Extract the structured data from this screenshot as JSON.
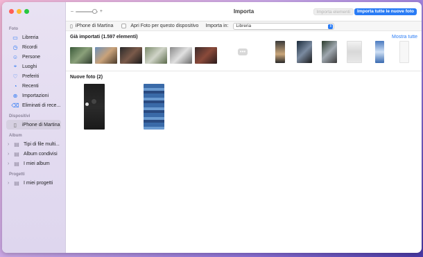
{
  "window": {
    "title": "Importa"
  },
  "sidebar": {
    "sections": [
      {
        "title": "Foto",
        "items": [
          {
            "label": "Libreria",
            "icon": "library-icon"
          },
          {
            "label": "Ricordi",
            "icon": "memories-icon"
          },
          {
            "label": "Persone",
            "icon": "people-icon"
          },
          {
            "label": "Luoghi",
            "icon": "places-icon"
          },
          {
            "label": "Preferiti",
            "icon": "heart-icon"
          },
          {
            "label": "Recenti",
            "icon": "clock-icon"
          },
          {
            "label": "Importazioni",
            "icon": "import-icon"
          },
          {
            "label": "Eliminati di rece...",
            "icon": "trash-icon"
          }
        ]
      },
      {
        "title": "Dispositivi",
        "items": [
          {
            "label": "iPhone di Martina",
            "icon": "iphone-icon"
          }
        ]
      },
      {
        "title": "Album",
        "items": [
          {
            "label": "Tipi di file multi...",
            "icon": "folder-icon"
          },
          {
            "label": "Album condivisi",
            "icon": "folder-icon"
          },
          {
            "label": "I miei album",
            "icon": "folder-icon"
          }
        ]
      },
      {
        "title": "Progetti",
        "items": [
          {
            "label": "I miei progetti",
            "icon": "folder-icon"
          }
        ]
      }
    ]
  },
  "titlebar": {
    "import_selected": "Importa elementi",
    "import_all": "Importa tutte le nuove foto"
  },
  "toolbar": {
    "device": "iPhone di Martina",
    "open_photos": "Apri Foto per questo dispositivo",
    "import_in_label": "Importa in:",
    "import_in_value": "Libreria"
  },
  "already_imported": {
    "title": "Già importati (1.597 elementi)",
    "show_all": "Mostra tutte"
  },
  "new_photos": {
    "title": "Nuove foto (2)"
  },
  "colors": {
    "accent": "#2a7cf5",
    "sidebar_bg": "#e9e2f3"
  }
}
